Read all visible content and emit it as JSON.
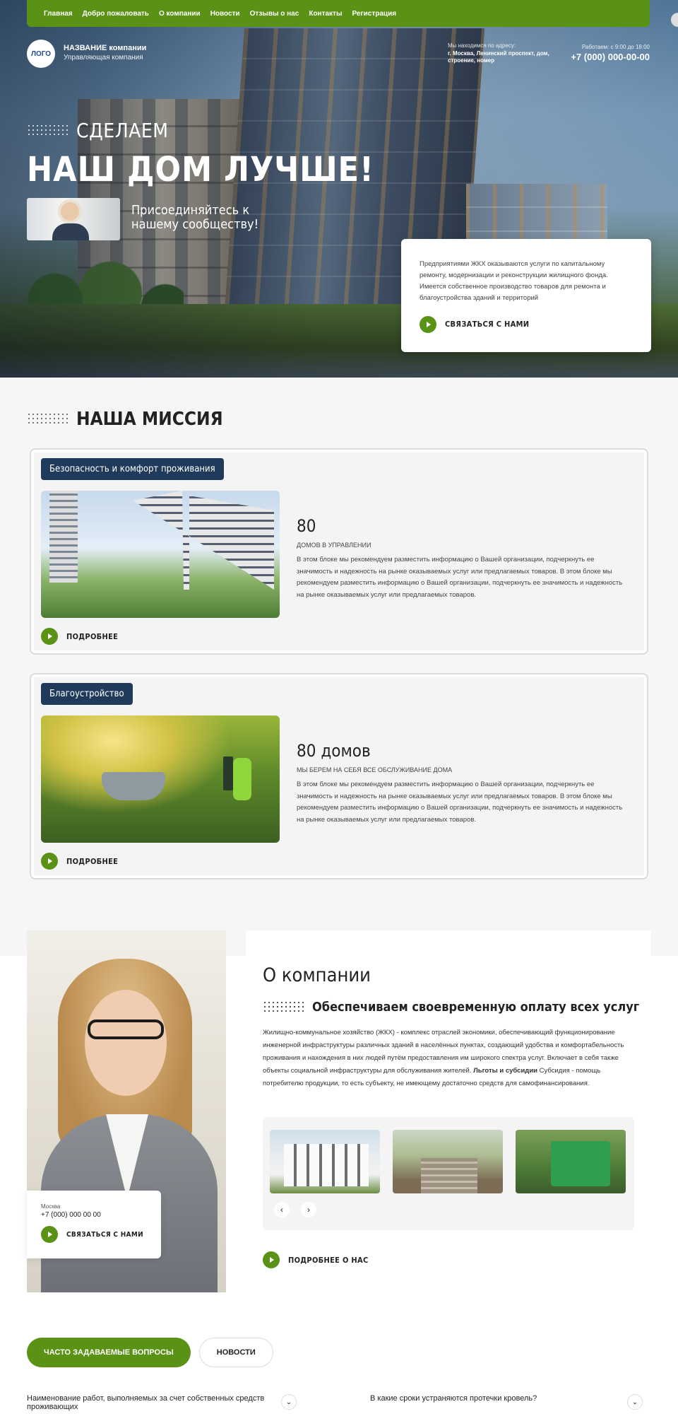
{
  "nav": {
    "items": [
      "Главная",
      "Добро пожаловать",
      "О компании",
      "Новости",
      "Отзывы о нас",
      "Контакты",
      "Регистрация"
    ]
  },
  "header": {
    "logo_text": "ЛОГО",
    "company_name": "НАЗВАНИЕ компании",
    "company_sub": "Управляющая компания",
    "address_label": "Мы находимся по адресу:",
    "address_value": "г. Москва, Ленинский проспект, дом, строение, номер",
    "hours_label": "Работаем: с 9:00 до 18:00",
    "phone": "+7 (000) 000-00-00"
  },
  "hero": {
    "eyebrow": "СДЕЛАЕМ",
    "title": "НАШ ДОМ ЛУЧШЕ!",
    "join_text": "Присоединяйтесь к нашему сообществу!",
    "card_text": "Предприятиями ЖКХ оказываются услуги по капитальному ремонту, модернизации и реконструкции жилищного фонда. Имеется собственное производство товаров для ремонта и благоустройства зданий и территорий",
    "cta_label": "СВЯЗАТЬСЯ С НАМИ"
  },
  "mission": {
    "title": "НАША МИССИЯ",
    "cards": [
      {
        "tag": "Безопасность и комфорт проживания",
        "number": "80",
        "subtitle": "ДОМОВ В УПРАВЛЕНИИ",
        "text": "В этом блоке мы рекомендуем разместить информацию о Вашей организации, подчеркнуть ее значимость и надежность на рынке оказываемых услуг или предлагаемых товаров. В этом блоке мы рекомендуем разместить информацию о Вашей организации, подчеркнуть ее значимость и надежность на рынке оказываемых услуг или предлагаемых товаров.",
        "more": "ПОДРОБНЕЕ"
      },
      {
        "tag": "Благоустройство",
        "number": "80 домов",
        "subtitle": "МЫ БЕРЕМ НА СЕБЯ ВСЕ ОБСЛУЖИВАНИЕ ДОМА",
        "text": "В этом блоке мы рекомендуем разместить информацию о Вашей организации, подчеркнуть ее значимость и надежность на рынке оказываемых услуг или предлагаемых товаров. В этом блоке мы рекомендуем разместить информацию о Вашей организации, подчеркнуть ее значимость и надежность на рынке оказываемых услуг или предлагаемых товаров.",
        "more": "ПОДРОБНЕЕ"
      }
    ]
  },
  "about": {
    "title": "О компании",
    "subtitle": "Обеспечиваем своевременную оплату всех услуг",
    "text_main": "Жилищно-коммунальное хозяйство (ЖКХ) - комплекс отраслей экономики, обеспечивающий функционирование инженерной инфраструктуры различных зданий в населённых пунктах, создающий удобства и комфортабельность проживания и нахождения в них людей путём предоставления им широкого спектра услуг. Включает в себя также объекты социальной инфраструктуры для обслуживания жителей.",
    "text_bold": "Льготы и субсидии",
    "text_tail": "Субсидия - помощь потребителю продукции, то есть субъекту, не имеющему достаточно средств для самофинансирования.",
    "arrow_prev": "‹",
    "arrow_next": "›",
    "more": "ПОДРОБНЕЕ О НАС",
    "contact_city": "Москва",
    "contact_phone": "+7 (000) 000 00 00",
    "contact_cta": "СВЯЗАТЬСЯ С НАМИ"
  },
  "faq": {
    "tabs": [
      "ЧАСТО ЗАДАВАЕМЫЕ ВОПРОСЫ",
      "НОВОСТИ"
    ],
    "active_tab": "ЧАСТО ЗАДАВАЕМЫЕ ВОПРОСЫ",
    "questions": [
      "Наименование работ, выполняемых за счет собственных средств проживающих",
      "В какие сроки устраняются протечки кровель?"
    ],
    "chevron": "⌄"
  },
  "colors": {
    "accent_green": "#5a9216",
    "tag_navy": "#1f3a5a"
  }
}
